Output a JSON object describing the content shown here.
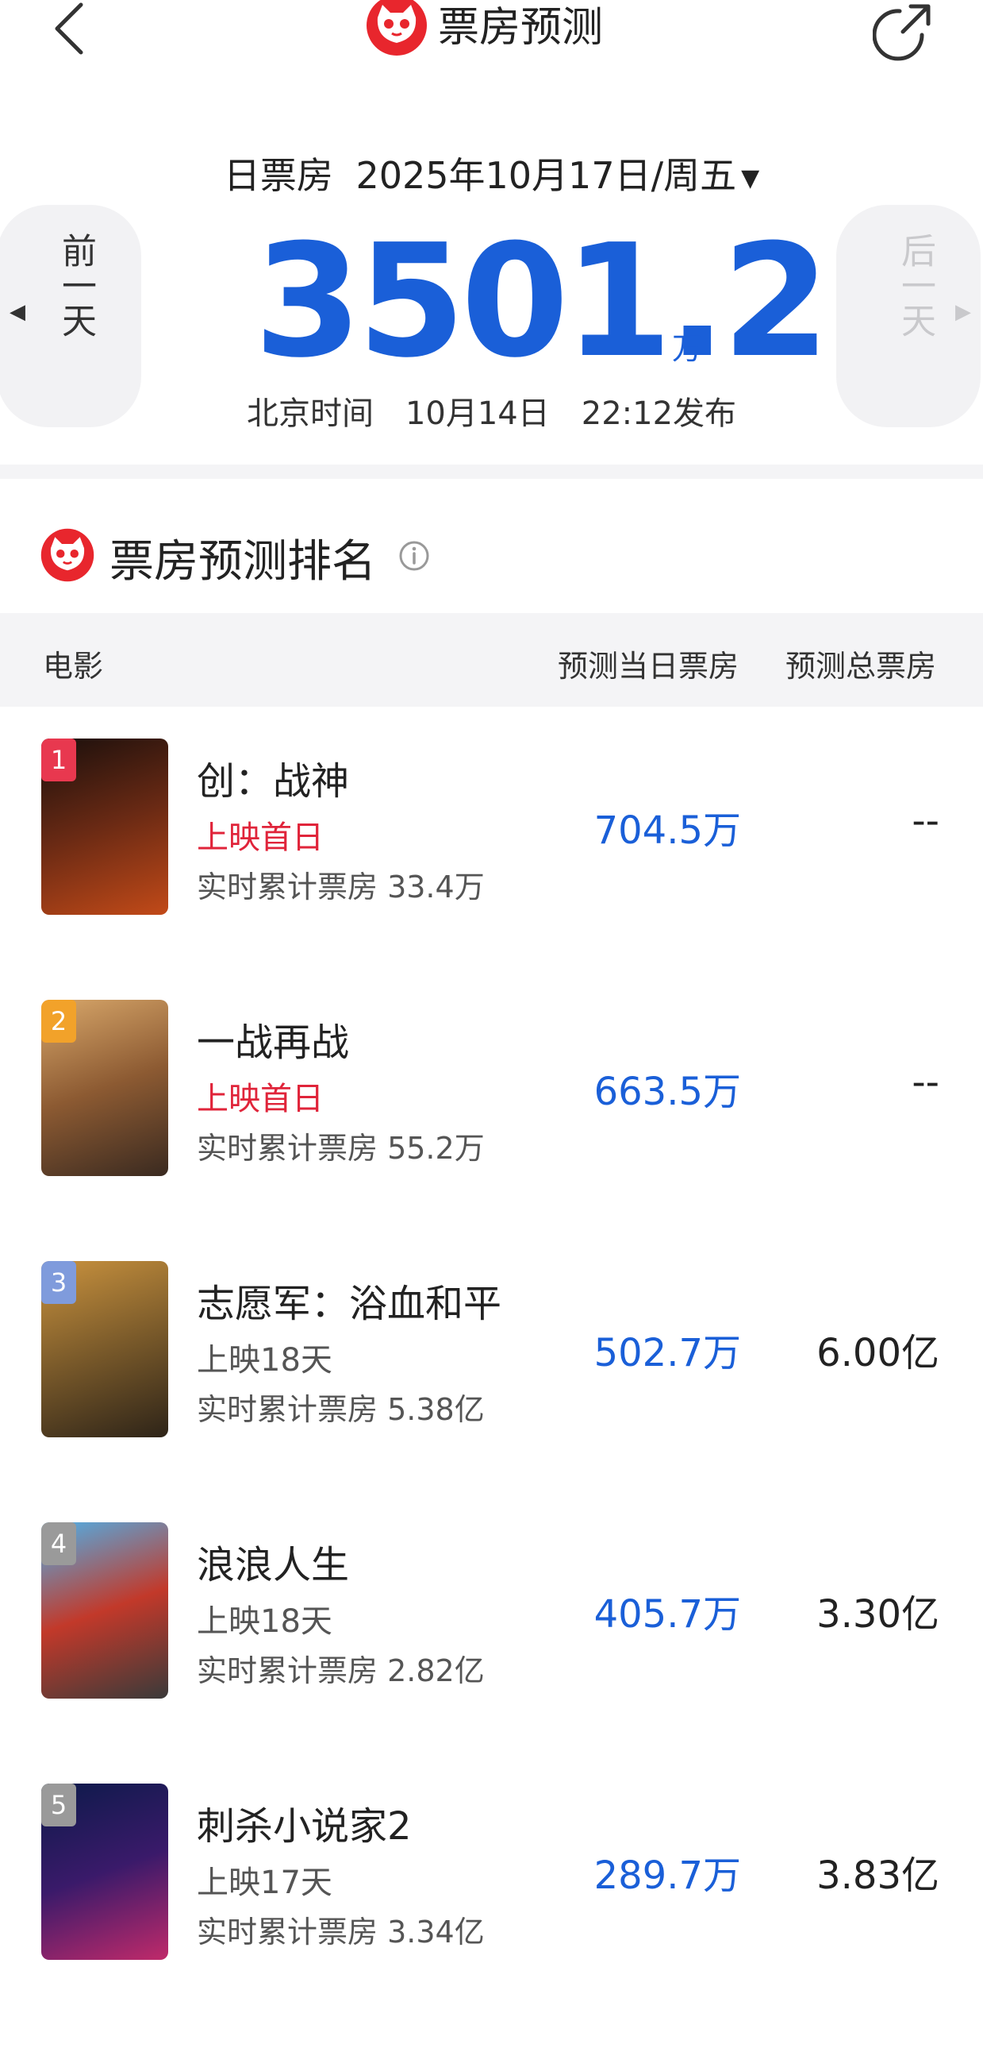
{
  "header": {
    "title": "票房预测"
  },
  "summary": {
    "date_prefix": "日票房",
    "date": "2025年10月17日/周五",
    "prev_label": "前一天",
    "next_label": "后一天",
    "box_office_value": "3501.2",
    "box_office_unit": "万",
    "publish_text": "北京时间　10月14日　22:12发布"
  },
  "ranking": {
    "title": "票房预测排名",
    "columns": {
      "movie": "电影",
      "day_forecast": "预测当日票房",
      "total_forecast": "预测总票房"
    },
    "rows": [
      {
        "rank": "1",
        "name": "创：战神",
        "release": "上映首日",
        "first_day": true,
        "cumulative": "实时累计票房 33.4万",
        "day_bo": "704.5万",
        "total_bo": "--",
        "badge_color": "#e8384f",
        "poster_colors": [
          "#1a0f0c",
          "#6b2a14",
          "#c24a18"
        ]
      },
      {
        "rank": "2",
        "name": "一战再战",
        "release": "上映首日",
        "first_day": true,
        "cumulative": "实时累计票房 55.2万",
        "day_bo": "663.5万",
        "total_bo": "--",
        "badge_color": "#f2a22a",
        "poster_colors": [
          "#d8a76a",
          "#8c5a32",
          "#3a2a20"
        ]
      },
      {
        "rank": "3",
        "name": "志愿军：浴血和平",
        "release": "上映18天",
        "first_day": false,
        "cumulative": "实时累计票房 5.38亿",
        "day_bo": "502.7万",
        "total_bo": "6.00亿",
        "badge_color": "#7f9bdc",
        "poster_colors": [
          "#c9923e",
          "#7a5a2a",
          "#2e2418"
        ]
      },
      {
        "rank": "4",
        "name": "浪浪人生",
        "release": "上映18天",
        "first_day": false,
        "cumulative": "实时累计票房 2.82亿",
        "day_bo": "405.7万",
        "total_bo": "3.30亿",
        "badge_color": "#9a9a9a",
        "poster_colors": [
          "#4fb0e8",
          "#c2392a",
          "#3a3a3a"
        ]
      },
      {
        "rank": "5",
        "name": "刺杀小说家2",
        "release": "上映17天",
        "first_day": false,
        "cumulative": "实时累计票房 3.34亿",
        "day_bo": "289.7万",
        "total_bo": "3.83亿",
        "badge_color": "#9a9a9a",
        "poster_colors": [
          "#0c1a4a",
          "#3a1a6a",
          "#c02a6a"
        ]
      }
    ]
  },
  "colors": {
    "accent_blue": "#1a5fd8",
    "first_day_red": "#e0243a",
    "logo_red": "#e8262d"
  }
}
